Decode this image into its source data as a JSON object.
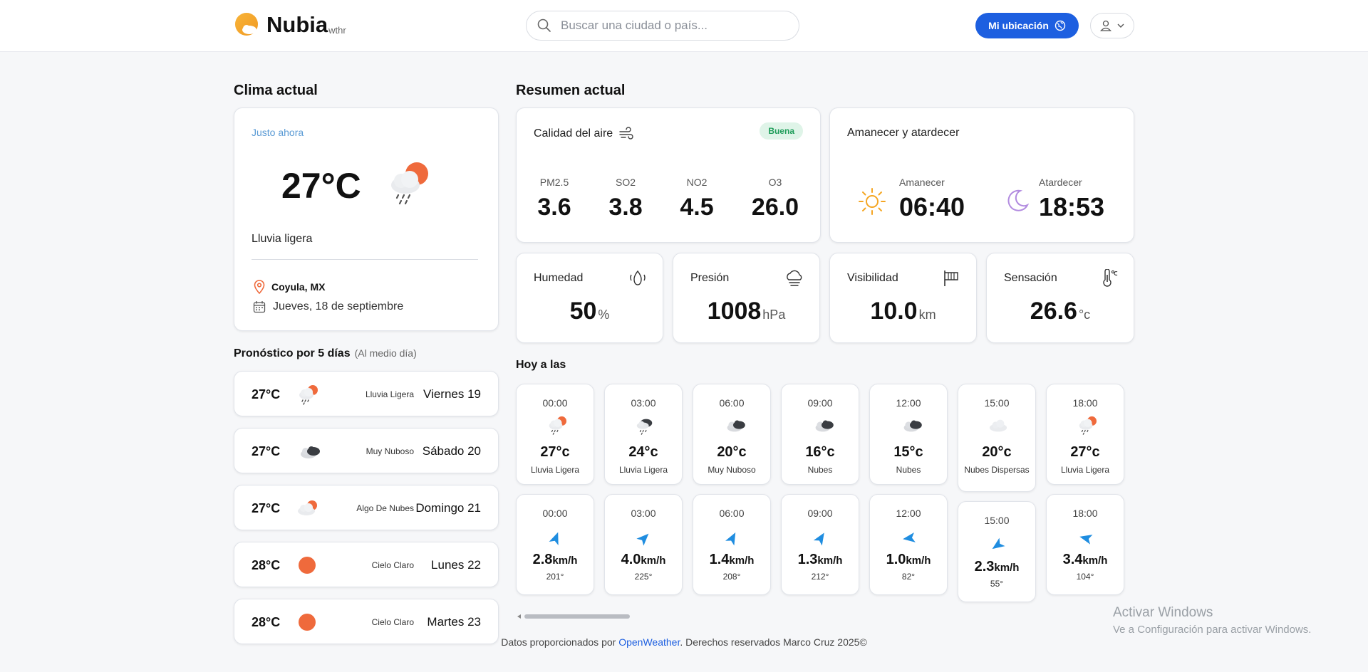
{
  "header": {
    "brand": "Nubia",
    "brand_sub": "wthr",
    "search_placeholder": "Buscar una ciudad o país...",
    "location_button": "Mi ubicación"
  },
  "current": {
    "section_title": "Clima actual",
    "label": "Justo ahora",
    "temp": "27°C",
    "description": "Lluvia ligera",
    "city": "Coyula, MX",
    "date": "Jueves, 18 de septiembre"
  },
  "forecast": {
    "title": "Pronóstico por 5 días",
    "subtitle": "(Al medio día)",
    "days": [
      {
        "temp": "27°C",
        "icon": "rain-sun-icon",
        "desc": "Lluvia Ligera",
        "day": "Viernes 19"
      },
      {
        "temp": "27°C",
        "icon": "dark-clouds-icon",
        "desc": "Muy Nuboso",
        "day": "Sábado 20"
      },
      {
        "temp": "27°C",
        "icon": "partly-cloudy-icon",
        "desc": "Algo De Nubes",
        "day": "Domingo 21"
      },
      {
        "temp": "28°C",
        "icon": "sun-icon",
        "desc": "Cielo Claro",
        "day": "Lunes 22"
      },
      {
        "temp": "28°C",
        "icon": "sun-icon",
        "desc": "Cielo Claro",
        "day": "Martes 23"
      }
    ]
  },
  "summary": {
    "title": "Resumen actual",
    "air": {
      "title": "Calidad del aire",
      "badge": "Buena",
      "items": [
        {
          "label": "PM2.5",
          "value": "3.6"
        },
        {
          "label": "SO2",
          "value": "3.8"
        },
        {
          "label": "NO2",
          "value": "4.5"
        },
        {
          "label": "O3",
          "value": "26.0"
        }
      ]
    },
    "sun": {
      "title": "Amanecer y atardecer",
      "sunrise_label": "Amanecer",
      "sunrise": "06:40",
      "sunset_label": "Atardecer",
      "sunset": "18:53"
    },
    "stats": [
      {
        "label": "Humedad",
        "value": "50",
        "unit": "%",
        "icon": "humidity-icon"
      },
      {
        "label": "Presión",
        "value": "1008",
        "unit": "hPa",
        "icon": "pressure-icon"
      },
      {
        "label": "Visibilidad",
        "value": "10.0",
        "unit": "km",
        "icon": "visibility-icon"
      },
      {
        "label": "Sensación",
        "value": "26.6",
        "unit": "°c",
        "icon": "thermometer-icon"
      }
    ]
  },
  "hourly": {
    "title": "Hoy a las",
    "weather": [
      {
        "time": "00:00",
        "icon": "rain-sun-icon",
        "temp": "27°c",
        "desc": "Lluvia Ligera"
      },
      {
        "time": "03:00",
        "icon": "rain-dark-icon",
        "temp": "24°c",
        "desc": "Lluvia Ligera"
      },
      {
        "time": "06:00",
        "icon": "dark-clouds-icon",
        "temp": "20°c",
        "desc": "Muy Nuboso"
      },
      {
        "time": "09:00",
        "icon": "dark-clouds-icon",
        "temp": "16°c",
        "desc": "Nubes"
      },
      {
        "time": "12:00",
        "icon": "dark-clouds-icon",
        "temp": "15°c",
        "desc": "Nubes"
      },
      {
        "time": "15:00",
        "icon": "light-cloud-icon",
        "temp": "20°c",
        "desc": "Nubes Dispersas"
      },
      {
        "time": "18:00",
        "icon": "rain-sun-icon",
        "temp": "27°c",
        "desc": "Lluvia Ligera"
      }
    ],
    "wind": [
      {
        "time": "00:00",
        "speed": "2.8",
        "unit": "km/h",
        "deg": "201°",
        "rotation": 201
      },
      {
        "time": "03:00",
        "speed": "4.0",
        "unit": "km/h",
        "deg": "225°",
        "rotation": 225
      },
      {
        "time": "06:00",
        "speed": "1.4",
        "unit": "km/h",
        "deg": "208°",
        "rotation": 208
      },
      {
        "time": "09:00",
        "speed": "1.3",
        "unit": "km/h",
        "deg": "212°",
        "rotation": 212
      },
      {
        "time": "12:00",
        "speed": "1.0",
        "unit": "km/h",
        "deg": "82°",
        "rotation": 82
      },
      {
        "time": "15:00",
        "speed": "2.3",
        "unit": "km/h",
        "deg": "55°",
        "rotation": 55
      },
      {
        "time": "18:00",
        "speed": "3.4",
        "unit": "km/h",
        "deg": "104°",
        "rotation": 104
      }
    ]
  },
  "footer": {
    "prefix": "Datos proporcionados por ",
    "link": "OpenWeather",
    "suffix": ". Derechos reservados Marco Cruz 2025©"
  },
  "watermark": {
    "line1": "Activar Windows",
    "line2": "Ve a Configuración para activar Windows."
  },
  "colors": {
    "accent": "#1d5fe0",
    "sun": "#ef6a3c",
    "good": "#1f9d5a"
  }
}
